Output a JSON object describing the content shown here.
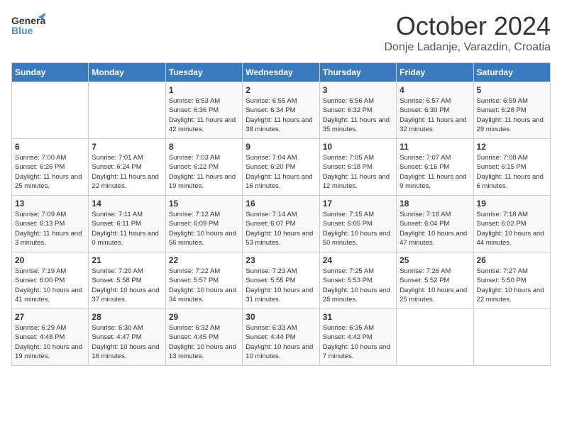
{
  "header": {
    "logo_general": "General",
    "logo_blue": "Blue",
    "month_title": "October 2024",
    "subtitle": "Donje Ladanje, Varazdin, Croatia"
  },
  "weekdays": [
    "Sunday",
    "Monday",
    "Tuesday",
    "Wednesday",
    "Thursday",
    "Friday",
    "Saturday"
  ],
  "weeks": [
    [
      {
        "day": "",
        "info": ""
      },
      {
        "day": "",
        "info": ""
      },
      {
        "day": "1",
        "info": "Sunrise: 6:53 AM\nSunset: 6:36 PM\nDaylight: 11 hours and 42 minutes."
      },
      {
        "day": "2",
        "info": "Sunrise: 6:55 AM\nSunset: 6:34 PM\nDaylight: 11 hours and 38 minutes."
      },
      {
        "day": "3",
        "info": "Sunrise: 6:56 AM\nSunset: 6:32 PM\nDaylight: 11 hours and 35 minutes."
      },
      {
        "day": "4",
        "info": "Sunrise: 6:57 AM\nSunset: 6:30 PM\nDaylight: 11 hours and 32 minutes."
      },
      {
        "day": "5",
        "info": "Sunrise: 6:59 AM\nSunset: 6:28 PM\nDaylight: 11 hours and 29 minutes."
      }
    ],
    [
      {
        "day": "6",
        "info": "Sunrise: 7:00 AM\nSunset: 6:26 PM\nDaylight: 11 hours and 25 minutes."
      },
      {
        "day": "7",
        "info": "Sunrise: 7:01 AM\nSunset: 6:24 PM\nDaylight: 11 hours and 22 minutes."
      },
      {
        "day": "8",
        "info": "Sunrise: 7:03 AM\nSunset: 6:22 PM\nDaylight: 11 hours and 19 minutes."
      },
      {
        "day": "9",
        "info": "Sunrise: 7:04 AM\nSunset: 6:20 PM\nDaylight: 11 hours and 16 minutes."
      },
      {
        "day": "10",
        "info": "Sunrise: 7:05 AM\nSunset: 6:18 PM\nDaylight: 11 hours and 12 minutes."
      },
      {
        "day": "11",
        "info": "Sunrise: 7:07 AM\nSunset: 6:16 PM\nDaylight: 11 hours and 9 minutes."
      },
      {
        "day": "12",
        "info": "Sunrise: 7:08 AM\nSunset: 6:15 PM\nDaylight: 11 hours and 6 minutes."
      }
    ],
    [
      {
        "day": "13",
        "info": "Sunrise: 7:09 AM\nSunset: 6:13 PM\nDaylight: 11 hours and 3 minutes."
      },
      {
        "day": "14",
        "info": "Sunrise: 7:11 AM\nSunset: 6:11 PM\nDaylight: 11 hours and 0 minutes."
      },
      {
        "day": "15",
        "info": "Sunrise: 7:12 AM\nSunset: 6:09 PM\nDaylight: 10 hours and 56 minutes."
      },
      {
        "day": "16",
        "info": "Sunrise: 7:14 AM\nSunset: 6:07 PM\nDaylight: 10 hours and 53 minutes."
      },
      {
        "day": "17",
        "info": "Sunrise: 7:15 AM\nSunset: 6:05 PM\nDaylight: 10 hours and 50 minutes."
      },
      {
        "day": "18",
        "info": "Sunrise: 7:16 AM\nSunset: 6:04 PM\nDaylight: 10 hours and 47 minutes."
      },
      {
        "day": "19",
        "info": "Sunrise: 7:18 AM\nSunset: 6:02 PM\nDaylight: 10 hours and 44 minutes."
      }
    ],
    [
      {
        "day": "20",
        "info": "Sunrise: 7:19 AM\nSunset: 6:00 PM\nDaylight: 10 hours and 41 minutes."
      },
      {
        "day": "21",
        "info": "Sunrise: 7:20 AM\nSunset: 5:58 PM\nDaylight: 10 hours and 37 minutes."
      },
      {
        "day": "22",
        "info": "Sunrise: 7:22 AM\nSunset: 5:57 PM\nDaylight: 10 hours and 34 minutes."
      },
      {
        "day": "23",
        "info": "Sunrise: 7:23 AM\nSunset: 5:55 PM\nDaylight: 10 hours and 31 minutes."
      },
      {
        "day": "24",
        "info": "Sunrise: 7:25 AM\nSunset: 5:53 PM\nDaylight: 10 hours and 28 minutes."
      },
      {
        "day": "25",
        "info": "Sunrise: 7:26 AM\nSunset: 5:52 PM\nDaylight: 10 hours and 25 minutes."
      },
      {
        "day": "26",
        "info": "Sunrise: 7:27 AM\nSunset: 5:50 PM\nDaylight: 10 hours and 22 minutes."
      }
    ],
    [
      {
        "day": "27",
        "info": "Sunrise: 6:29 AM\nSunset: 4:48 PM\nDaylight: 10 hours and 19 minutes."
      },
      {
        "day": "28",
        "info": "Sunrise: 6:30 AM\nSunset: 4:47 PM\nDaylight: 10 hours and 16 minutes."
      },
      {
        "day": "29",
        "info": "Sunrise: 6:32 AM\nSunset: 4:45 PM\nDaylight: 10 hours and 13 minutes."
      },
      {
        "day": "30",
        "info": "Sunrise: 6:33 AM\nSunset: 4:44 PM\nDaylight: 10 hours and 10 minutes."
      },
      {
        "day": "31",
        "info": "Sunrise: 6:35 AM\nSunset: 4:42 PM\nDaylight: 10 hours and 7 minutes."
      },
      {
        "day": "",
        "info": ""
      },
      {
        "day": "",
        "info": ""
      }
    ]
  ]
}
